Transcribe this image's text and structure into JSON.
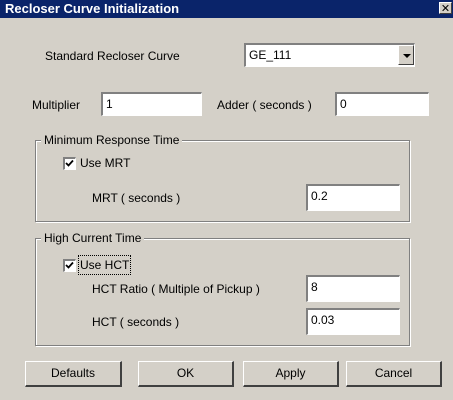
{
  "window": {
    "title": "Recloser Curve Initialization",
    "close_glyph": "✕"
  },
  "standard_curve": {
    "label": "Standard Recloser Curve",
    "value": "GE_111"
  },
  "multiplier": {
    "label": "Multiplier",
    "value": "1"
  },
  "adder": {
    "label": "Adder ( seconds )",
    "value": "0"
  },
  "mrt_group": {
    "title": "Minimum Response Time",
    "checkbox_label": "Use MRT",
    "checked": true,
    "field_label": "MRT  ( seconds )",
    "field_value": "0.2"
  },
  "hct_group": {
    "title": "High Current Time",
    "checkbox_label": "Use HCT",
    "checked": true,
    "ratio_label": "HCT Ratio  ( Multiple of Pickup )",
    "ratio_value": "8",
    "time_label": "HCT  ( seconds )",
    "time_value": "0.03"
  },
  "buttons": {
    "defaults": "Defaults",
    "ok": "OK",
    "apply": "Apply",
    "cancel": "Cancel"
  },
  "icons": {
    "close": "close-icon",
    "dropdown": "chevron-down-icon",
    "checkmark": "checkmark-icon"
  }
}
